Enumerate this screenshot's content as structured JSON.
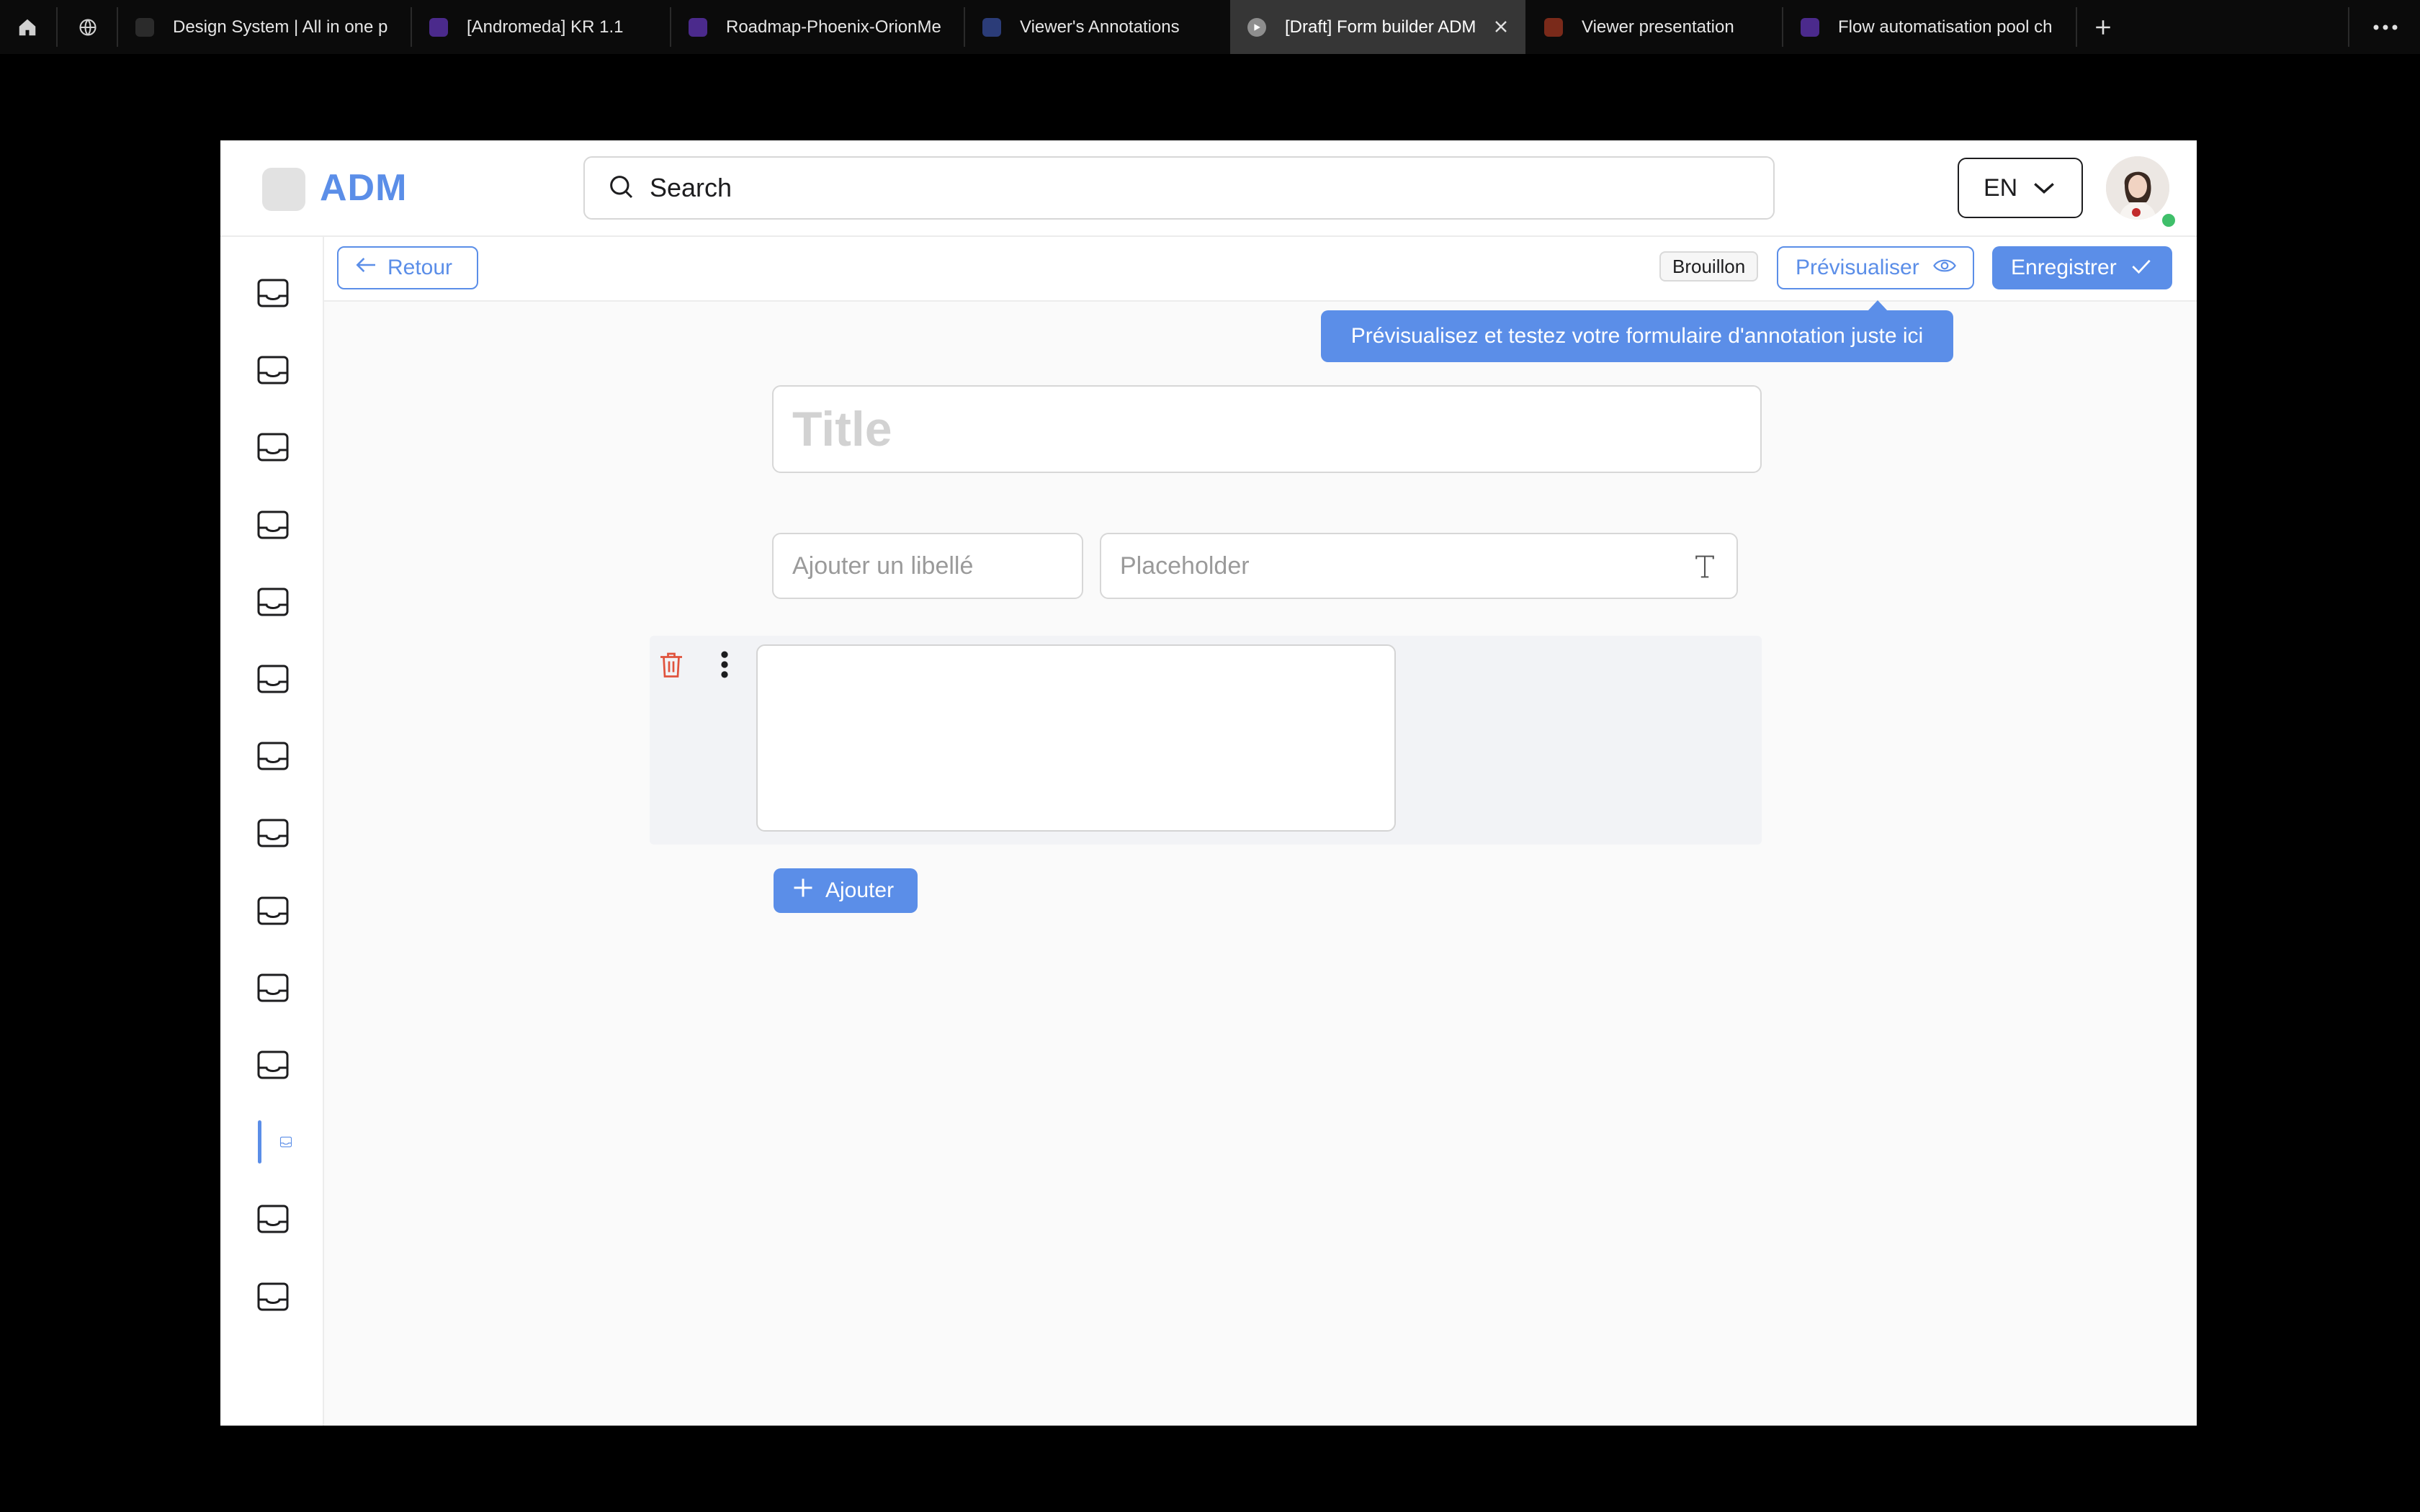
{
  "browser": {
    "tabs": [
      {
        "label": "Design System | All in one p",
        "favicon_color": "#2b2b2b"
      },
      {
        "label": "[Andromeda] KR 1.1",
        "favicon_color": "#4b2a8c"
      },
      {
        "label": "Roadmap-Phoenix-OrionMe",
        "favicon_color": "#4b2a8c"
      },
      {
        "label": "Viewer's Annotations",
        "favicon_color": "#2b3c78"
      },
      {
        "label": "[Draft] Form builder ADM",
        "favicon_color": "#8e8e8e"
      },
      {
        "label": "Viewer presentation",
        "favicon_color": "#7a2a1a"
      },
      {
        "label": "Flow automatisation pool ch",
        "favicon_color": "#4b2a8c"
      }
    ],
    "active_tab_index": 4
  },
  "app": {
    "logo_text": "ADM",
    "search_placeholder": "Search",
    "language": "EN",
    "accent_color": "#5b8ee8",
    "online_status_color": "#3fbf6a"
  },
  "sidebar": {
    "item_count": 14,
    "active_index": 11,
    "icon": "inbox-tray-icon"
  },
  "toolbar": {
    "back_label": "Retour",
    "status_badge": "Brouillon",
    "preview_label": "Prévisualiser",
    "save_label": "Enregistrer"
  },
  "tooltip": {
    "text": "Prévisualisez et testez votre formulaire d'annotation juste ici"
  },
  "form": {
    "title_placeholder": "Title",
    "label_placeholder": "Ajouter un libellé",
    "field_placeholder": "Placeholder",
    "add_label": "Ajouter"
  }
}
